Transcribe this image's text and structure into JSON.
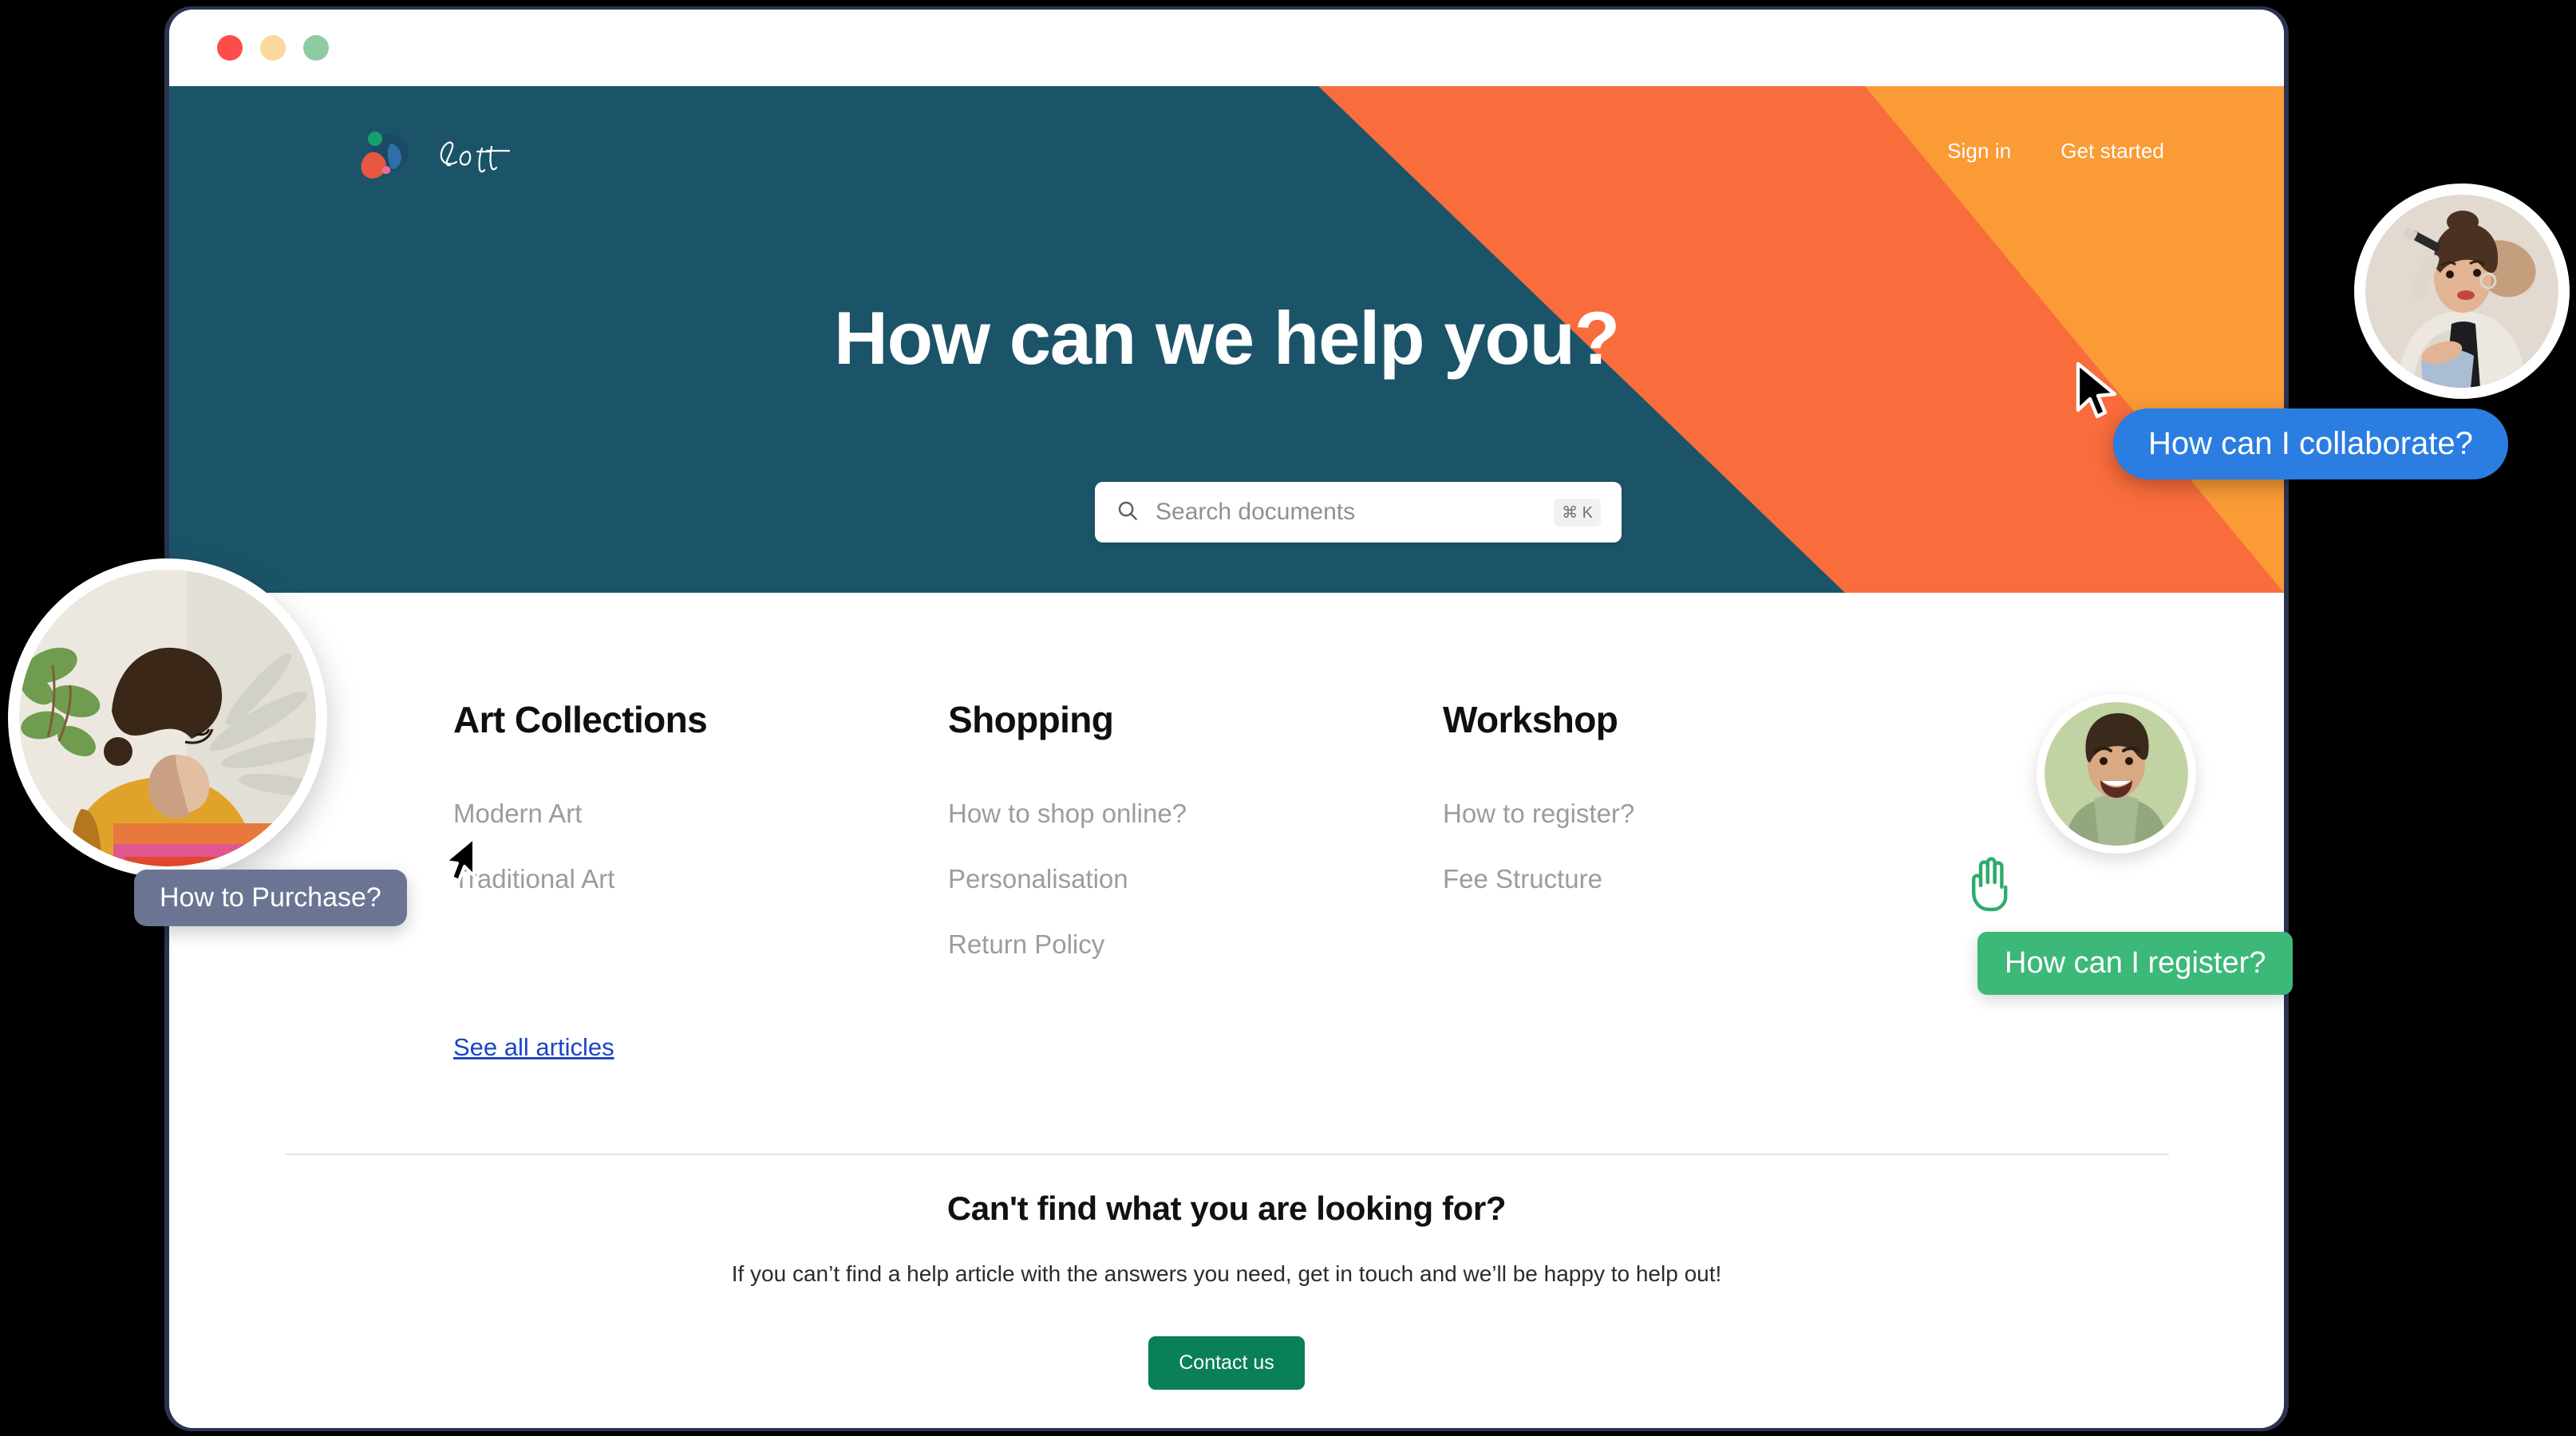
{
  "window": {
    "traffic_lights": [
      {
        "name": "close",
        "color": "#fc4d4b"
      },
      {
        "name": "minimize",
        "color": "#fbd89b"
      },
      {
        "name": "maximize",
        "color": "#8ecba1"
      }
    ]
  },
  "theme": {
    "teal": "#1b5469",
    "orange": "#f96c3c",
    "orange_light": "#fb9b35",
    "green_button": "#098057",
    "link_blue": "#1a46c4",
    "frame_navy": "#2b3350",
    "page_background": "#000000"
  },
  "header": {
    "brand_name": "Loft",
    "logo_icon": "abstract-blob-logo",
    "nav": [
      {
        "label": "Sign in",
        "name": "sign-in-link"
      },
      {
        "label": "Get started",
        "name": "get-started-link"
      }
    ]
  },
  "hero": {
    "title": "How can we help you?",
    "search": {
      "icon": "search-icon",
      "placeholder": "Search documents",
      "value": "",
      "shortcut": "⌘ K"
    }
  },
  "content": {
    "columns": [
      {
        "heading": "Art Collections",
        "links": [
          "Modern Art",
          "Traditional Art"
        ]
      },
      {
        "heading": "Shopping",
        "links": [
          "How to shop online?",
          "Personalisation",
          "Return Policy"
        ]
      },
      {
        "heading": "Workshop",
        "links": [
          "How to register?",
          "Fee Structure"
        ]
      }
    ],
    "see_all_label": "See all articles"
  },
  "cta": {
    "heading": "Can't find what you are looking for?",
    "description": "If you can’t find a help article with the answers you need, get in touch and we’ll be happy to help out!",
    "button_label": "Contact us"
  },
  "overlays": {
    "bubbles": [
      {
        "name": "bubble-collaborate",
        "text": "How can I collaborate?",
        "color": "#2b7de1"
      },
      {
        "name": "bubble-register",
        "text": "How can I register?",
        "color": "#3cb878"
      },
      {
        "name": "bubble-purchase",
        "text": "How to Purchase?",
        "color": "#6b7593"
      }
    ],
    "avatars": [
      {
        "name": "avatar-woman-sweater",
        "alt": "woman in striped sweater with plants"
      },
      {
        "name": "avatar-woman-painter",
        "alt": "woman holding paintbrush"
      },
      {
        "name": "avatar-smiling-man",
        "alt": "smiling man in green shirt"
      }
    ],
    "cursors": [
      {
        "name": "pointer-cursor-top-right",
        "icon": "arrow-cursor-icon"
      },
      {
        "name": "pointer-cursor-left",
        "icon": "arrow-cursor-icon"
      },
      {
        "name": "hand-cursor",
        "icon": "hand-icon",
        "color": "#2eac6b"
      }
    ]
  }
}
